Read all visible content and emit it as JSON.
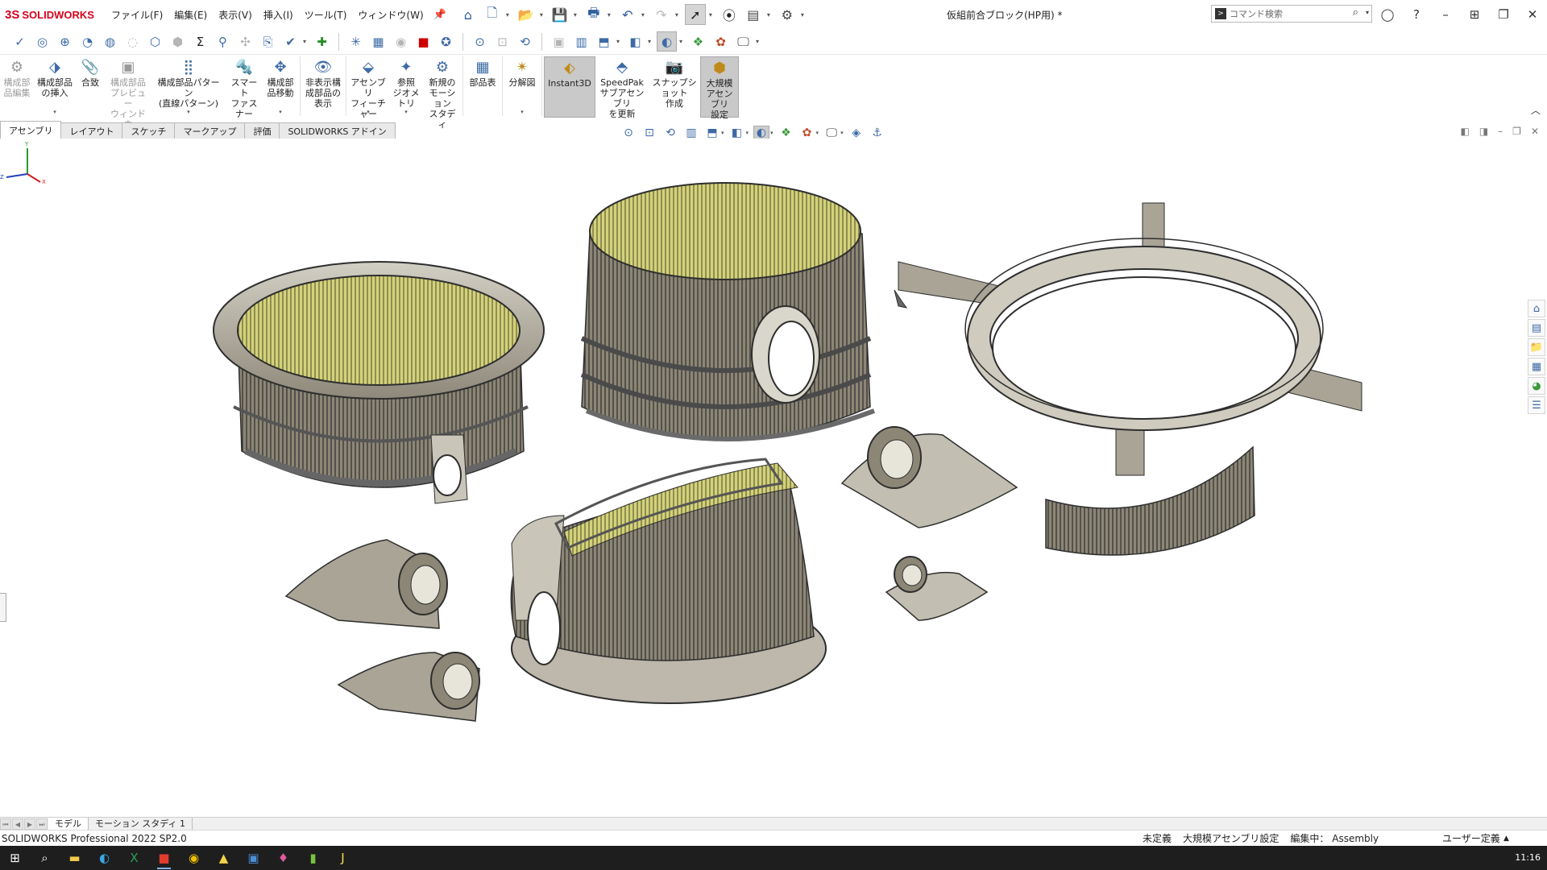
{
  "app": {
    "brand_ds": "3S",
    "brand_name": "SOLIDWORKS",
    "document_title": "仮組前合ブロック(HP用) *"
  },
  "menus": [
    "ファイル(F)",
    "編集(E)",
    "表示(V)",
    "挿入(I)",
    "ツール(T)",
    "ウィンドウ(W)"
  ],
  "search": {
    "placeholder": "コマンド検索"
  },
  "ribbon": {
    "buttons": [
      {
        "label": "構成部\n品編集",
        "disabled": true
      },
      {
        "label": "構成部品\nの挿入",
        "disabled": false
      },
      {
        "label": "合致",
        "disabled": false
      },
      {
        "label": "構成部品\nプレビュー\nウィンドウ",
        "disabled": true
      },
      {
        "label": "構成部品パターン\n(直線パターン)",
        "disabled": false
      },
      {
        "label": "スマート\nファスナー",
        "disabled": false
      },
      {
        "label": "構成部\n品移動",
        "disabled": false
      },
      {
        "label": "非表示構\n成部品の\n表示",
        "disabled": false
      },
      {
        "label": "アセンブリ\nフィーチャー",
        "disabled": false
      },
      {
        "label": "参照\nジオメトリ",
        "disabled": false
      },
      {
        "label": "新規の\nモーション\nスタディ",
        "disabled": false
      },
      {
        "label": "部品表",
        "disabled": false
      },
      {
        "label": "分解図",
        "disabled": false
      },
      {
        "label": "Instant3D",
        "disabled": false
      },
      {
        "label": "SpeedPak\nサブアセンブリ\nを更新",
        "disabled": false
      },
      {
        "label": "スナップショット\n作成",
        "disabled": false
      },
      {
        "label": "大規模\nアセンブリ\n設定",
        "disabled": false
      }
    ]
  },
  "tabs": [
    "アセンブリ",
    "レイアウト",
    "スケッチ",
    "マークアップ",
    "評価",
    "SOLIDWORKS アドイン"
  ],
  "bottom_tabs": [
    "モデル",
    "モーション スタディ 1"
  ],
  "status": {
    "app_version": "SOLIDWORKS Professional 2022 SP2.0",
    "definition": "未定義",
    "large_assembly": "大規模アセンブリ設定",
    "editing": "編集中： Assembly",
    "units": "ユーザー定義"
  },
  "taskbar": {
    "clock": "11:16"
  },
  "colors": {
    "brand_red": "#d6001c",
    "model_shade": "#8c8676",
    "model_edge": "#2e2e2e",
    "interior_yellow": "#d4d27a"
  }
}
